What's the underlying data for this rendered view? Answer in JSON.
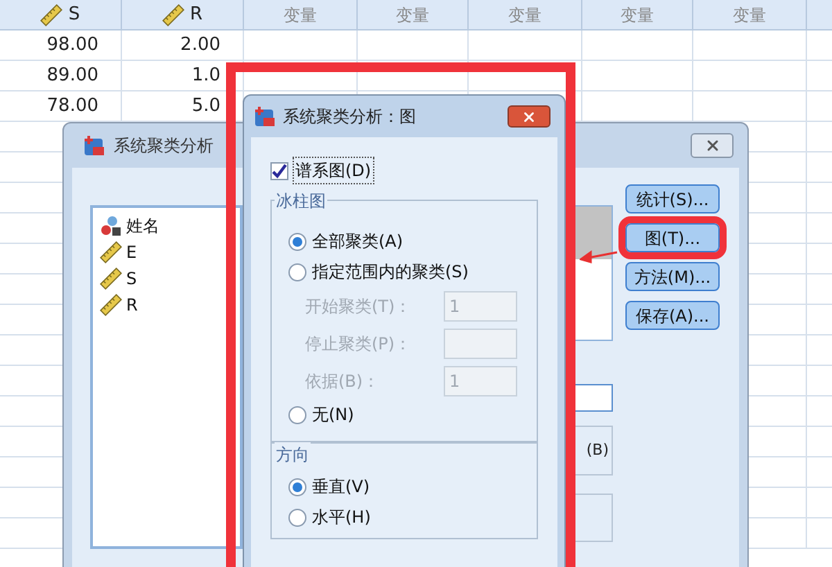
{
  "grid": {
    "columns": [
      {
        "label": "S",
        "kind": "scale"
      },
      {
        "label": "R",
        "kind": "scale"
      },
      {
        "label": "变量",
        "kind": "empty"
      },
      {
        "label": "变量",
        "kind": "empty"
      },
      {
        "label": "变量",
        "kind": "empty"
      },
      {
        "label": "变量",
        "kind": "empty"
      },
      {
        "label": "变量",
        "kind": "empty"
      }
    ],
    "rows": [
      [
        "98.00",
        "2.00"
      ],
      [
        "89.00",
        "1.0"
      ],
      [
        "78.00",
        "5.0"
      ]
    ]
  },
  "main_dialog": {
    "title": "系统聚类分析",
    "variables": [
      {
        "name": "姓名",
        "kind": "string"
      },
      {
        "name": "E",
        "kind": "scale"
      },
      {
        "name": "S",
        "kind": "scale"
      },
      {
        "name": "R",
        "kind": "scale"
      }
    ],
    "partial_label": "(B)",
    "buttons": [
      {
        "label": "统计(S)...",
        "highlighted": false
      },
      {
        "label": "图(T)...",
        "highlighted": true
      },
      {
        "label": "方法(M)...",
        "highlighted": false
      },
      {
        "label": "保存(A)...",
        "highlighted": false
      }
    ]
  },
  "plots_dialog": {
    "title": "系统聚类分析：图",
    "dendrogram": {
      "label": "谱系图(D)",
      "checked": true
    },
    "icicle": {
      "title": "冰柱图",
      "options": [
        {
          "label": "全部聚类(A)",
          "selected": true
        },
        {
          "label": "指定范围内的聚类(S)",
          "selected": false
        },
        {
          "label": "无(N)",
          "selected": false
        }
      ],
      "fields": [
        {
          "label": "开始聚类(T)：",
          "value": "1",
          "disabled": true
        },
        {
          "label": "停止聚类(P)：",
          "disabled": true
        },
        {
          "label": "依据(B)：",
          "value": "1",
          "disabled": true
        }
      ]
    },
    "orientation": {
      "title": "方向",
      "options": [
        {
          "label": "垂直(V)",
          "selected": true
        },
        {
          "label": "水平(H)",
          "selected": false
        }
      ]
    }
  }
}
